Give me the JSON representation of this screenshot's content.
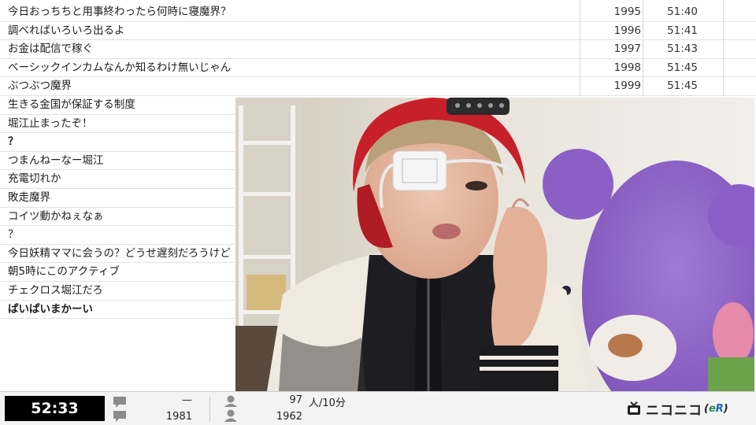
{
  "comments_top": [
    {
      "text": "今日おっちちと用事終わったら何時に寝魔界？",
      "no": "1995",
      "time": "51:40"
    },
    {
      "text": "調べればいろいろ出るよ",
      "no": "1996",
      "time": "51:41"
    },
    {
      "text": "お金は配信で稼ぐ",
      "no": "1997",
      "time": "51:43"
    },
    {
      "text": "ベーシックインカムなんか知るわけ無いじゃん",
      "no": "1998",
      "time": "51:45"
    },
    {
      "text": "ぶつぶつ魔界",
      "no": "1999",
      "time": "51:45"
    }
  ],
  "comments_left": [
    {
      "text": "生きる金国が保証する制度",
      "bold": false
    },
    {
      "text": "堀江止まったぞ！",
      "bold": false
    },
    {
      "text": "？",
      "bold": true
    },
    {
      "text": "つまんねーなー堀江",
      "bold": false
    },
    {
      "text": "充電切れか",
      "bold": false
    },
    {
      "text": "敗走魔界",
      "bold": false
    },
    {
      "text": "コイツ動かねぇなぁ",
      "bold": false
    },
    {
      "text": "？",
      "bold": false
    },
    {
      "text": "今日妖精ママに会うの？どうせ遅刻だろうけど",
      "bold": false
    },
    {
      "text": "朝5時にこのアクティブ",
      "bold": false
    },
    {
      "text": "チェクロス堀江だろ",
      "bold": false
    },
    {
      "text": "ぱいぱいまかーい",
      "bold": true
    }
  ],
  "bottom_bar": {
    "elapsed": "52:33",
    "comment_stat_top": "—",
    "comment_stat_bottom": "1981",
    "viewer_stat_top": "97",
    "viewer_unit": "人/10分",
    "viewer_stat_bottom": "1962",
    "logo_text": "ニコニコ",
    "logo_suffix": "(eR)"
  },
  "icons": {
    "comment": "speech-bubble-icon",
    "viewer": "person-icon",
    "logo": "niconico-tv-icon"
  },
  "colors": {
    "elapsed_bg": "#000000",
    "logo_e": "#2a8f4b",
    "logo_r": "#1f5fbf",
    "cap_red": "#c8202a",
    "bear_purple": "#8a5fc4"
  }
}
